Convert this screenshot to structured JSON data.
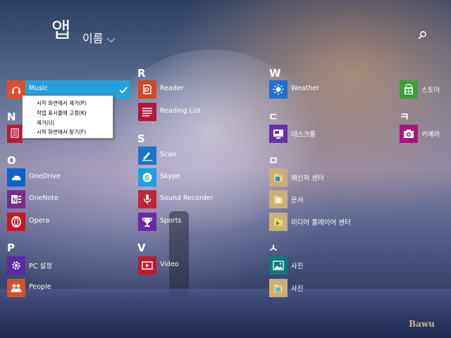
{
  "header": {
    "title": "앱",
    "sort_label": "이름 ⌵"
  },
  "watermark": "Bawu",
  "letters": {
    "r": "R",
    "w": "W",
    "n": "N",
    "d": "ㄷ",
    "k": "ㅋ",
    "s": "S",
    "m": "ㅁ",
    "o": "O",
    "p": "P",
    "v": "V",
    "si": "ㅅ"
  },
  "apps": {
    "music": "Music",
    "reader": "Reader",
    "weather": "Weather",
    "store": "스토어",
    "reading_list": "Reading List",
    "desktop": "데스크톱",
    "camera": "카메라",
    "scan": "Scan",
    "skype": "Skype",
    "messenger": "메신저 센터",
    "onedrive": "OneDrive",
    "sound_recorder": "Sound Recorder",
    "documents": "문서",
    "onenote": "OneNote",
    "opera": "Opera",
    "sports": "Sports",
    "media_player": "미디어 플레이어 센터",
    "pc_settings": "PC 설정",
    "video": "Video",
    "photos": "사진",
    "people": "People",
    "pictures": "사진"
  },
  "context_menu": {
    "unpin_start": "시작 화면에서 제거(P)",
    "pin_taskbar": "작업 표시줄에 고정(K)",
    "uninstall": "제거(U)",
    "find_start": "시작 화면에서 찾기(F)"
  },
  "colors": {
    "music": "#e04e27",
    "reader": "#d24726",
    "weather": "#1e6fd0",
    "store": "#3aa13a",
    "reading_list": "#b4163a",
    "desktop": "#6b2fa6",
    "camera": "#a5177d",
    "scan": "#1976c8",
    "skype": "#1aa0e0",
    "onedrive": "#0a64c8",
    "sound_recorder": "#c0263b",
    "onenote": "#7a2c8a",
    "opera": "#c8171e",
    "sports": "#6a2aa5",
    "pc_settings": "#5c2aa5",
    "video": "#c0182e",
    "people": "#d2522a",
    "photos": "#0a7a7a",
    "selected": "#26a0da"
  }
}
